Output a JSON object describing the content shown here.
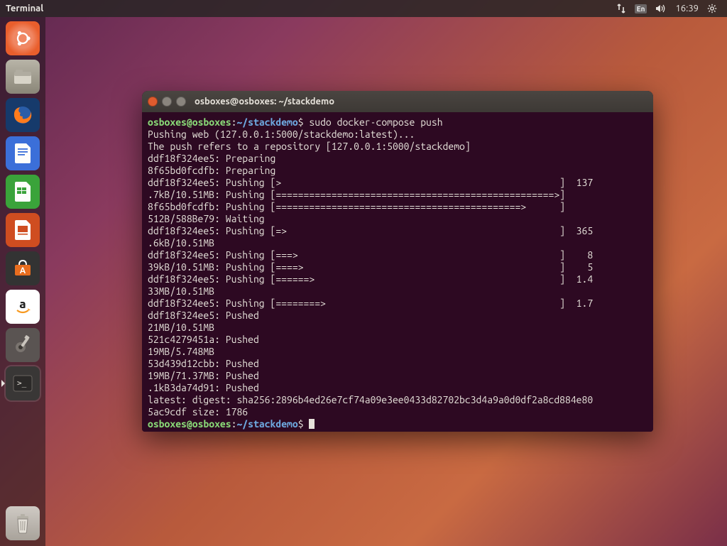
{
  "menubar": {
    "title": "Terminal",
    "lang": "En",
    "time": "16:39"
  },
  "launcher": {
    "items": [
      {
        "name": "ubuntu-dash"
      },
      {
        "name": "files"
      },
      {
        "name": "firefox"
      },
      {
        "name": "libreoffice-writer"
      },
      {
        "name": "libreoffice-calc"
      },
      {
        "name": "libreoffice-impress"
      },
      {
        "name": "ubuntu-software"
      },
      {
        "name": "amazon"
      },
      {
        "name": "system-settings"
      },
      {
        "name": "terminal"
      }
    ],
    "trash": "trash"
  },
  "terminal": {
    "title": "osboxes@osboxes: ~/stackdemo",
    "prompt": {
      "user": "osboxes",
      "at": "@",
      "host": "osboxes",
      "colon": ":",
      "path": "~/stackdemo",
      "dollar": "$"
    },
    "command": "sudo docker-compose push",
    "lines": [
      "Pushing web (127.0.0.1:5000/stackdemo:latest)...",
      "The push refers to a repository [127.0.0.1:5000/stackdemo]",
      "ddf18f324ee5: Preparing",
      "8f65bd0fcdfb: Preparing",
      "ddf18f324ee5: Pushing [>                                                  ]  137",
      ".7kB/10.51MB: Pushing [==================================================>]",
      "8f65bd0fcdfb: Pushing [============================================>      ]",
      "512B/588Be79: Waiting",
      "ddf18f324ee5: Pushing [=>                                                 ]  365",
      ".6kB/10.51MB",
      "ddf18f324ee5: Pushing [===>                                               ]    8",
      "39kB/10.51MB: Pushing [====>                                              ]    5",
      "ddf18f324ee5: Pushing [======>                                            ]  1.4",
      "33MB/10.51MB",
      "ddf18f324ee5: Pushing [========>                                          ]  1.7",
      "ddf18f324ee5: Pushed",
      "21MB/10.51MB",
      "521c4279451a: Pushed",
      "19MB/5.748MB",
      "53d439d12cbb: Pushed",
      "19MB/71.37MB: Pushed",
      ".1kB3da74d91: Pushed",
      "latest: digest: sha256:2896b4ed26e7cf74a09e3ee0433d82702bc3d4a9a0d0df2a8cd884e80",
      "5ac9cdf size: 1786"
    ]
  }
}
